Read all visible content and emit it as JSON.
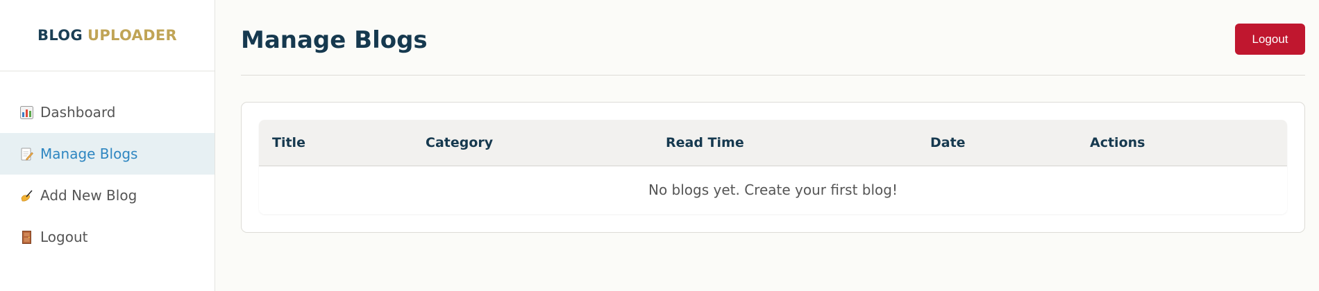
{
  "brand": {
    "part1": "BLOG",
    "part2": "UPLOADER"
  },
  "sidebar": {
    "items": [
      {
        "label": "Dashboard",
        "icon": "bar-chart-icon",
        "active": false
      },
      {
        "label": "Manage Blogs",
        "icon": "memo-icon",
        "active": true
      },
      {
        "label": "Add New Blog",
        "icon": "writing-hand-icon",
        "active": false
      },
      {
        "label": "Logout",
        "icon": "door-icon",
        "active": false
      }
    ]
  },
  "header": {
    "title": "Manage Blogs",
    "logout_label": "Logout"
  },
  "table": {
    "columns": [
      "Title",
      "Category",
      "Read Time",
      "Date",
      "Actions"
    ],
    "empty_message": "No blogs yet. Create your first blog!"
  },
  "colors": {
    "primary": "#16394f",
    "accent": "#c0a456",
    "danger": "#c0172f",
    "active_link": "#2e86c1",
    "active_bg": "#e7f0f3"
  }
}
